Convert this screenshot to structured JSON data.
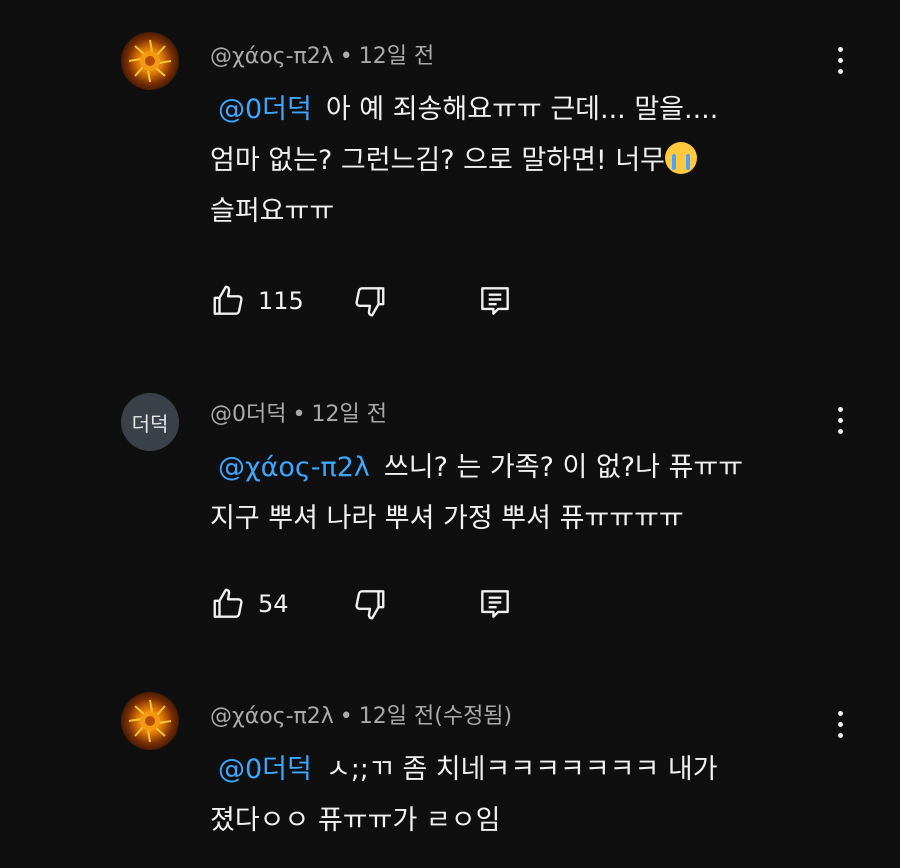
{
  "comments": [
    {
      "author": "@χάος-π2λ",
      "separator": "•",
      "time": "12일 전",
      "avatar_text": "",
      "mention": "@0더덕",
      "lines": [
        "아 예 죄송해요ㅠㅠ 근데... 말을....",
        "엄마 없는? 그런느김? 으로 말하면! 너무",
        "슬퍼요ㅠㅠ"
      ],
      "emoji": "loudly-crying-face",
      "likes": "115"
    },
    {
      "author": "@0더덕",
      "separator": "•",
      "time": "12일 전",
      "avatar_text": "더덕",
      "mention": "@χάος-π2λ",
      "lines": [
        "쓰니? 는 가족? 이 없?나 퓨ㅠㅠ",
        "지구 뿌셔 나라 뿌셔 가정 뿌셔 퓨ㅠㅠㅠㅠ"
      ],
      "likes": "54"
    },
    {
      "author": "@χάος-π2λ",
      "separator": "•",
      "time": "12일 전(수정됨)",
      "avatar_text": "",
      "mention": "@0더덕",
      "lines": [
        "ㅅ;;ㄲ 좀 치네ㅋㅋㅋㅋㅋㅋㅋ 내가",
        "졌다ㅇㅇ 퓨ㅠㅠ가 ㄹㅇ임"
      ]
    }
  ],
  "icons": {
    "like": "thumbs-up-icon",
    "dislike": "thumbs-down-icon",
    "reply": "reply-icon",
    "more": "more-vertical-icon"
  },
  "colors": {
    "background": "#0f0f0f",
    "mention": "#3ea6ff",
    "meta": "#aaaaaa",
    "text": "#f1f1f1"
  }
}
